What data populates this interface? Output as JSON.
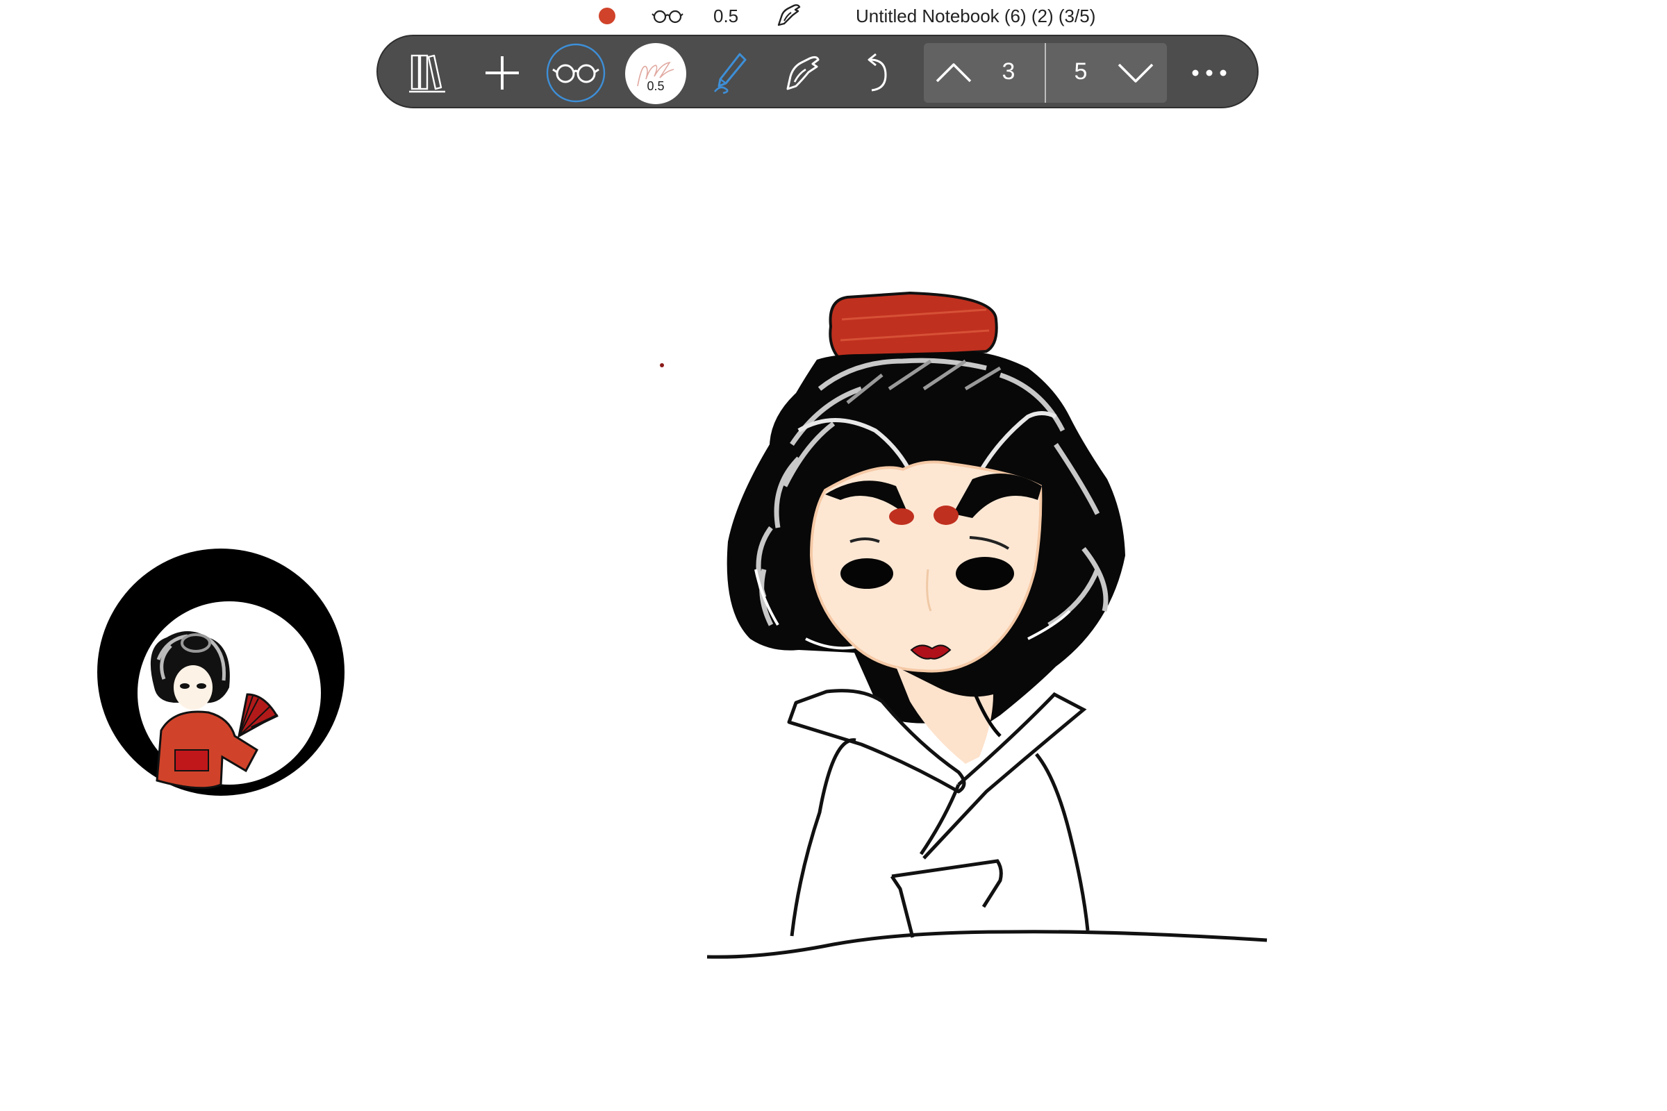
{
  "status_bar": {
    "pen_color": "#d0432a",
    "reading_mode_icon": "glasses-icon",
    "pen_size": "0.5",
    "touch_icon": "hand-pen-icon",
    "notebook_title": "Untitled Notebook (6) (2) (3/5)"
  },
  "toolbar": {
    "library_icon": "library-icon",
    "add_icon": "plus-icon",
    "reading_mode_icon": "glasses-icon",
    "pen_size_label": "0.5",
    "pen_tool_icon": "pen-icon",
    "touch_draw_icon": "hand-pen-icon",
    "undo_icon": "undo-icon",
    "prev_page_icon": "chevron-up-icon",
    "current_page": "3",
    "total_pages": "5",
    "next_page_icon": "chevron-down-icon",
    "more_icon": "more-icon",
    "accent_color": "#3d8fd8"
  },
  "canvas": {
    "drawing": "geisha-sketch",
    "sticker": "geisha-sticker-icon"
  }
}
